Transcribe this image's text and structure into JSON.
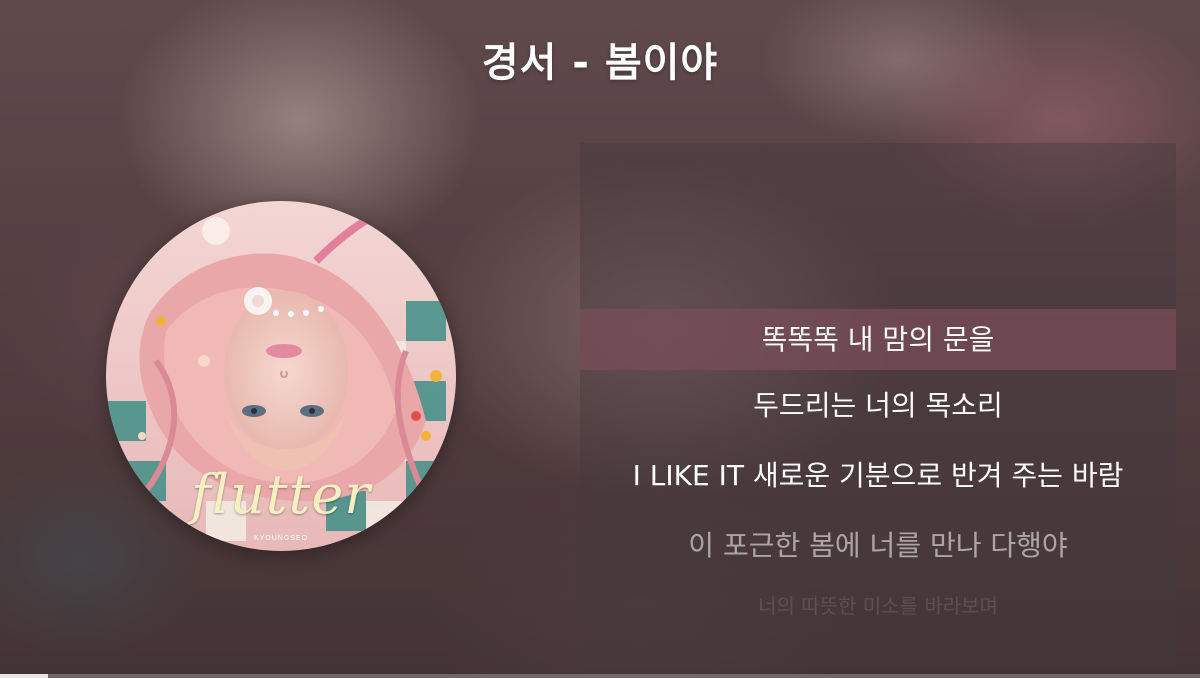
{
  "video": {
    "title": "경서 - 봄이야"
  },
  "album": {
    "title": "flutter",
    "artist": "KYOUNGSEO"
  },
  "lyrics": [
    "똑똑똑 내 맘의 문을",
    "두드리는 너의 목소리",
    "I LIKE IT 새로운 기분으로 반겨 주는 바람",
    "이 포근한 봄에 너를 만나 다행야",
    "너의 따뜻한 미소를 바라보며"
  ],
  "active_lyric_index": 0,
  "progress": {
    "fraction": 0.04
  },
  "colors": {
    "active_lyric_bg": "#784e58",
    "album_title": "#f6efc2",
    "text": "#ffffff"
  }
}
